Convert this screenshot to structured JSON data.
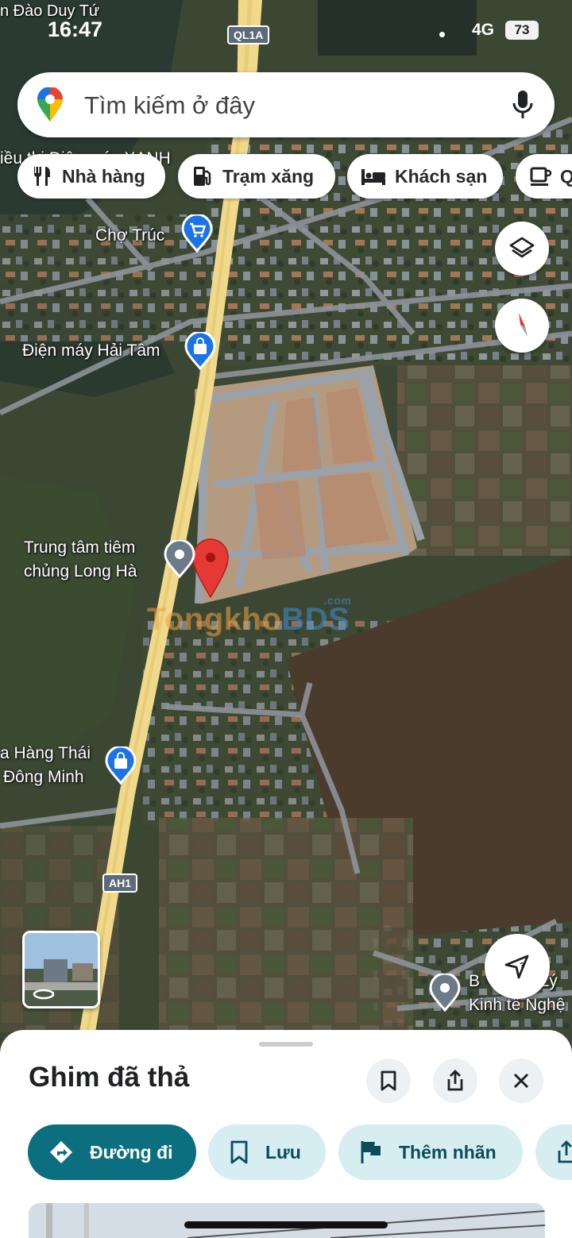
{
  "status_bar": {
    "time": "16:47",
    "network": "4G",
    "battery": "73"
  },
  "search": {
    "placeholder": "Tìm kiếm ở đây"
  },
  "chips": [
    {
      "label": "Nhà hàng",
      "icon": "restaurant-icon"
    },
    {
      "label": "Trạm xăng",
      "icon": "gas-station-icon"
    },
    {
      "label": "Khách sạn",
      "icon": "hotel-icon"
    },
    {
      "label": "Q",
      "icon": "coffee-icon"
    }
  ],
  "map": {
    "labels": {
      "top_street": "n Đào Duy Tứ",
      "top_area": "iều thị Điện máy XANH",
      "top_area_suffix": "G",
      "cho_truc": "Chợ Trúc",
      "dien_may": "Điện máy Hải Tâm",
      "trung_tam_line1": "Trung tâm tiêm",
      "trung_tam_line2": "chủng Long Hà",
      "nha_hang_line1": "a Hàng Thái",
      "nha_hang_line2": "Đông Minh",
      "bottom_right_line1": "B",
      "bottom_right_line1b": "n Lý",
      "bottom_right_line2": "Kinh tế Nghệ"
    },
    "road_shields": {
      "ql1a": "QL1A",
      "ah1": "AH1"
    },
    "watermark": {
      "part1": "Tong",
      "part2": "kho",
      "part3": "BDS",
      "suffix": ".com"
    },
    "colors": {
      "highway": "#f0d98a",
      "pin_red": "#e53935",
      "poi_blue": "#1a73e8"
    }
  },
  "controls": {
    "layers": "layers-icon",
    "compass": "compass-icon",
    "location": "location-arrow-icon",
    "streetview": "street-view-thumbnail"
  },
  "sheet": {
    "title": "Ghim đã thả",
    "actions": {
      "directions": "Đường đi",
      "save": "Lưu",
      "label": "Thêm nhãn"
    }
  }
}
